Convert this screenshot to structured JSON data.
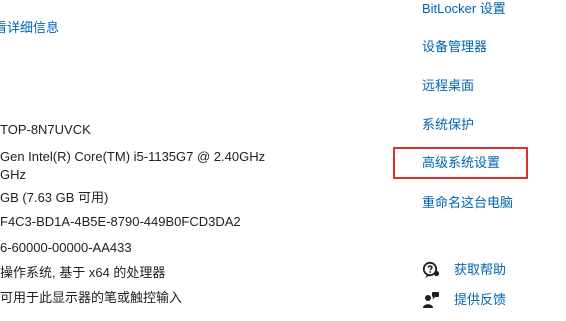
{
  "left": {
    "details_link": "看详细信息",
    "lines": [
      "TOP-8N7UVCK",
      "Gen Intel(R) Core(TM) i5-1135G7 @ 2.40GHz",
      "GHz",
      "GB (7.63 GB 可用)",
      "F4C3-BD1A-4B5E-8790-449B0FCD3DA2",
      "6-60000-00000-AA433",
      "操作系统, 基于 x64 的处理器",
      "可用于此显示器的笔或触控输入"
    ]
  },
  "right": {
    "links": [
      "BitLocker 设置",
      "设备管理器",
      "远程桌面",
      "系统保护",
      "高级系统设置",
      "重命名这台电脑"
    ],
    "help": {
      "get_help": "获取帮助",
      "feedback": "提供反馈"
    }
  },
  "icons": {
    "get_help": "help-chat-icon",
    "feedback": "feedback-person-icon"
  },
  "colors": {
    "link": "#0063b1",
    "highlight_border": "#e0302d"
  }
}
